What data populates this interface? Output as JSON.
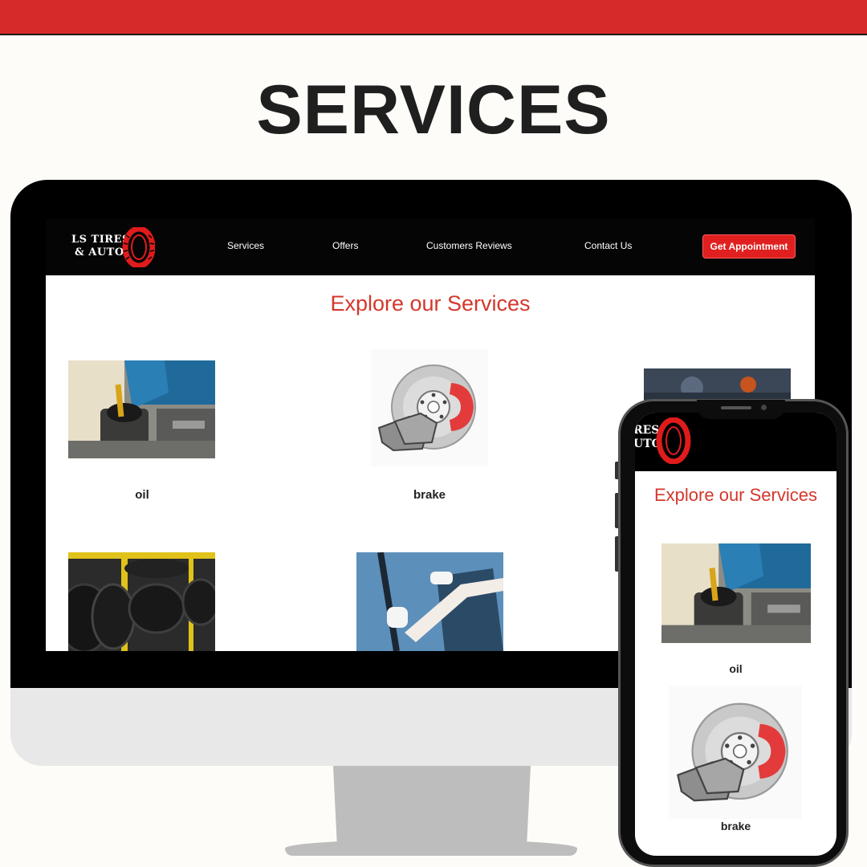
{
  "headline": "SERVICES",
  "brand": {
    "line1": "LS TIRES",
    "line2": "& AUTO"
  },
  "nav": {
    "items": [
      "Services",
      "Offers",
      "Customers Reviews",
      "Contact Us"
    ],
    "cta": "Get Appointment"
  },
  "section_title": "Explore our Services",
  "services": [
    {
      "label": "oil"
    },
    {
      "label": "brake"
    }
  ],
  "mobile": {
    "brand_partial": "RES\nUTO",
    "section_title": "Explore our Services",
    "services": [
      {
        "label": "oil"
      },
      {
        "label": "brake"
      }
    ]
  },
  "colors": {
    "accent": "#d42a2a",
    "button": "#e02020",
    "title": "#d4372c",
    "nav_bg": "#050505"
  }
}
